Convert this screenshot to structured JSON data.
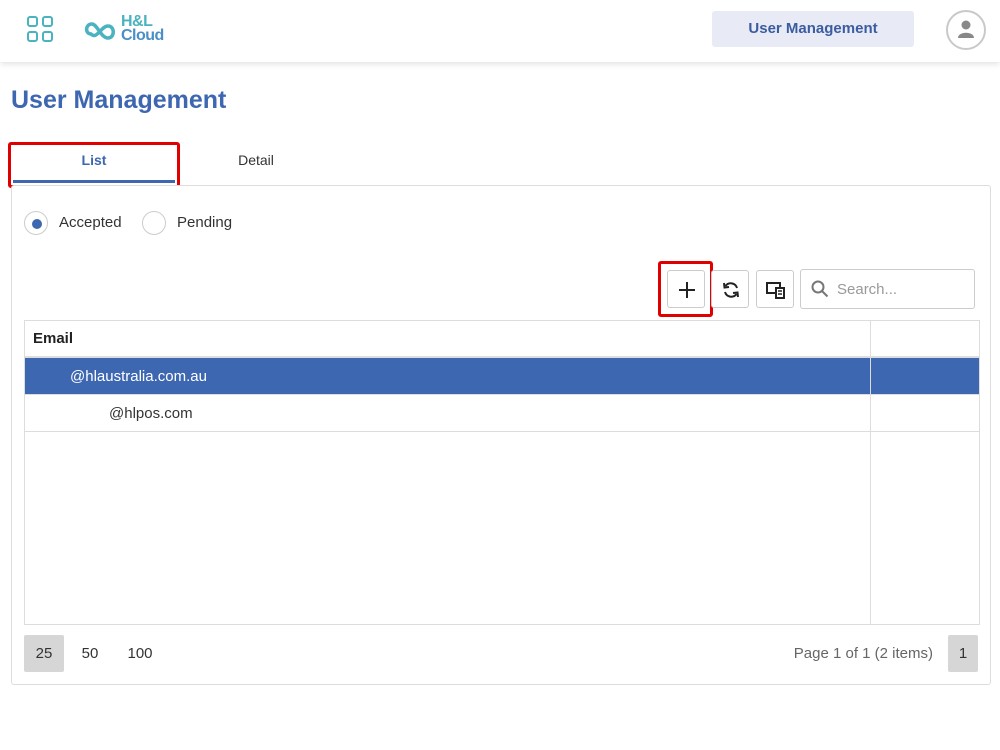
{
  "header": {
    "logo_line1": "H&L",
    "logo_line2": "Cloud",
    "nav_button": "User Management",
    "brand_colors": {
      "teal": "#4bb3bf",
      "blue": "#4a8fc7"
    }
  },
  "page": {
    "title": "User Management",
    "accent_color": "#3e67b1"
  },
  "tabs": [
    {
      "label": "List",
      "active": true
    },
    {
      "label": "Detail",
      "active": false
    }
  ],
  "filters": {
    "options": [
      {
        "label": "Accepted",
        "selected": true
      },
      {
        "label": "Pending",
        "selected": false
      }
    ]
  },
  "toolbar": {
    "add_icon": "plus-icon",
    "refresh_icon": "refresh-icon",
    "columns_icon": "column-chooser-icon",
    "search_placeholder": "Search..."
  },
  "grid": {
    "columns": [
      "Email",
      ""
    ],
    "rows": [
      {
        "email": "@hlaustralia.com.au",
        "selected": true
      },
      {
        "email": "@hlpos.com",
        "selected": false
      }
    ]
  },
  "pager": {
    "page_sizes": [
      "25",
      "50",
      "100"
    ],
    "selected_page_size": "25",
    "info": "Page 1 of 1 (2 items)",
    "current_page": "1"
  }
}
